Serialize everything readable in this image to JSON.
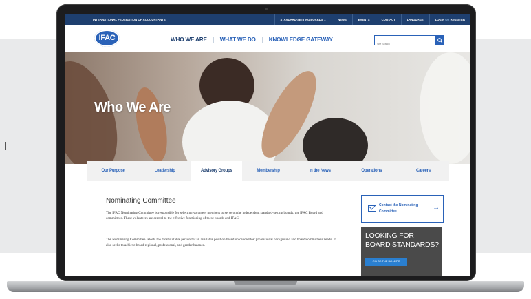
{
  "topbar": {
    "org": "INTERNATIONAL FEDERATION OF ACCOUNTANTS",
    "links": [
      "STANDARD-SETTING BOARDS ⌄",
      "NEWS",
      "EVENTS",
      "CONTACT",
      "LANGUAGE"
    ],
    "login": "LOGIN",
    "login_or": "OR",
    "register": "REGISTER"
  },
  "header": {
    "logo": "IFAC",
    "nav": [
      "WHO WE ARE",
      "WHAT WE DO",
      "KNOWLEDGE GATEWAY"
    ],
    "search_placeholder": "Site Search",
    "search_icon": "search-icon"
  },
  "hero": {
    "title": "Who We Are"
  },
  "tabs": [
    "Our Purpose",
    "Leadership",
    "Advisory Groups",
    "Membership",
    "In the News",
    "Operations",
    "Careers"
  ],
  "active_tab": "Advisory Groups",
  "content": {
    "heading": "Nominating Committee",
    "p1": "The IFAC Nominating Committee is responsible for selecting volunteer members to serve on the independent standard-setting boards, the IFAC Board and committees. These volunteers are central to the effective functioning of these boards and IFAC.",
    "p2": "The Nominating Committee selects the most suitable person for an available position based on candidates' professional background and board/committee's needs. It also seeks to achieve broad regional, professional, and gender balance."
  },
  "sidebar": {
    "contact_label": "Contact the Nominating Committee",
    "contact_icon": "envelope-icon",
    "arrow_icon": "arrow-right-icon",
    "looking_title": "LOOKING FOR BOARD STANDARDS?",
    "looking_btn": "GO TO THE BOARDS"
  },
  "colors": {
    "navy": "#1e3f6f",
    "blue": "#2a62b8",
    "dark_panel": "#4a4a4a"
  }
}
